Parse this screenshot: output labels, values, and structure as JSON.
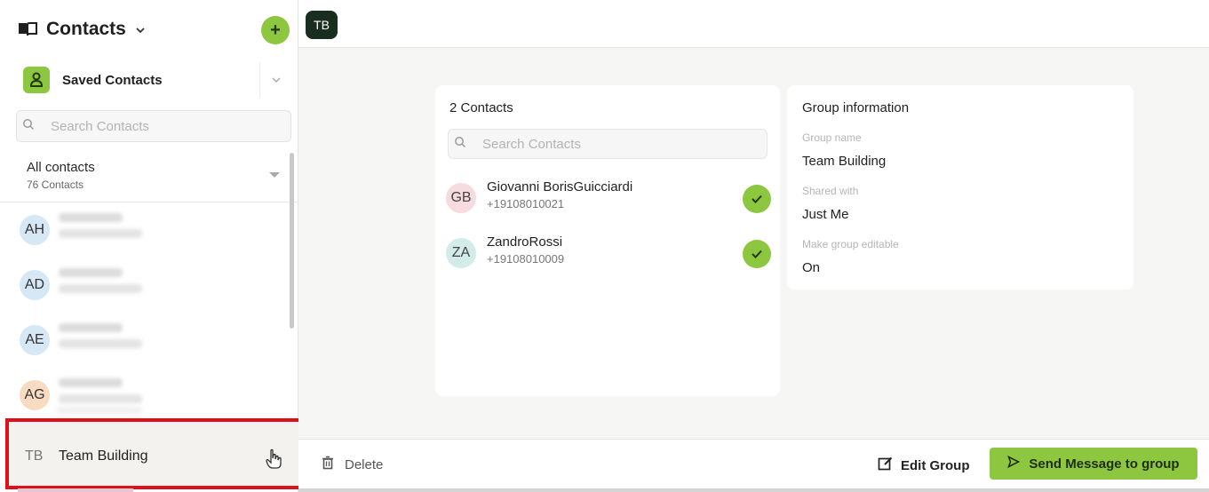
{
  "sidebar": {
    "title": "Contacts",
    "add_label": "+",
    "saved_label": "Saved Contacts",
    "search_placeholder": "Search Contacts",
    "all_label": "All contacts",
    "all_count": "76 Contacts",
    "contacts": [
      {
        "initials": "AH",
        "color": "#d6e7f5"
      },
      {
        "initials": "AD",
        "color": "#d6e7f5"
      },
      {
        "initials": "AE",
        "color": "#d6e7f5"
      },
      {
        "initials": "AG",
        "color": "#f8dcc1"
      }
    ],
    "selected_group": {
      "initials": "TB",
      "name": "Team Building"
    }
  },
  "header": {
    "badge": "TB"
  },
  "members_card": {
    "title": "2 Contacts",
    "search_placeholder": "Search Contacts",
    "members": [
      {
        "initials": "GB",
        "name": "Giovanni BorisGuicciardi",
        "phone": "+19108010021",
        "color": "#f6dbe0"
      },
      {
        "initials": "ZA",
        "name": "ZandroRossi",
        "phone": "+19108010009",
        "color": "#d3ecea"
      }
    ]
  },
  "info_card": {
    "title": "Group information",
    "fields": [
      {
        "label": "Group name",
        "value": "Team Building"
      },
      {
        "label": "Shared with",
        "value": "Just Me"
      },
      {
        "label": "Make group editable",
        "value": "On"
      }
    ]
  },
  "footer": {
    "delete_label": "Delete",
    "edit_label": "Edit Group",
    "send_label": "Send Message to group"
  },
  "colors": {
    "accent": "#8dc63f",
    "highlight": "#e0101a",
    "badge": "#1a2e20"
  }
}
